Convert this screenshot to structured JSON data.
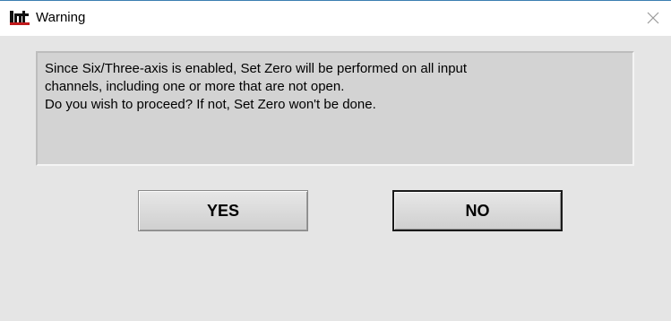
{
  "window": {
    "title": "Warning",
    "app_icon": "lint-logo-icon",
    "close_icon": "close-icon"
  },
  "message": {
    "lines": [
      "Since Six/Three-axis is enabled, Set Zero will be performed on all input",
      "channels, including one or more that are not open.",
      "Do you wish to proceed? If not, Set Zero won't be done."
    ]
  },
  "buttons": {
    "yes_label": "YES",
    "no_label": "NO"
  },
  "colors": {
    "logo_red": "#c0191b",
    "title_border": "#3c7fb1"
  }
}
